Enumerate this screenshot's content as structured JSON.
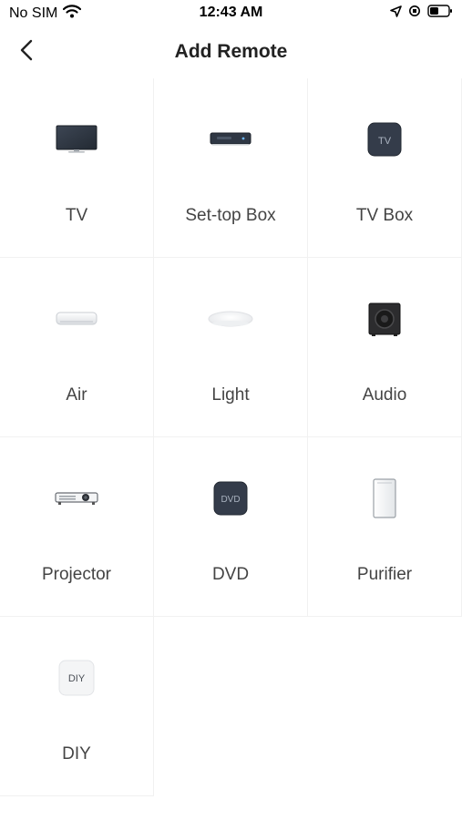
{
  "status_bar": {
    "carrier": "No SIM",
    "time": "12:43 AM"
  },
  "header": {
    "title": "Add Remote"
  },
  "devices": [
    {
      "label": "TV",
      "icon": "tv-icon"
    },
    {
      "label": "Set-top Box",
      "icon": "set-top-box-icon"
    },
    {
      "label": "TV Box",
      "icon": "tv-box-icon",
      "icon_text": "TV"
    },
    {
      "label": "Air",
      "icon": "air-conditioner-icon"
    },
    {
      "label": "Light",
      "icon": "ceiling-light-icon"
    },
    {
      "label": "Audio",
      "icon": "speaker-icon"
    },
    {
      "label": "Projector",
      "icon": "projector-icon"
    },
    {
      "label": "DVD",
      "icon": "dvd-player-icon",
      "icon_text": "DVD"
    },
    {
      "label": "Purifier",
      "icon": "air-purifier-icon"
    },
    {
      "label": "DIY",
      "icon": "diy-icon",
      "icon_text": "DIY"
    }
  ]
}
